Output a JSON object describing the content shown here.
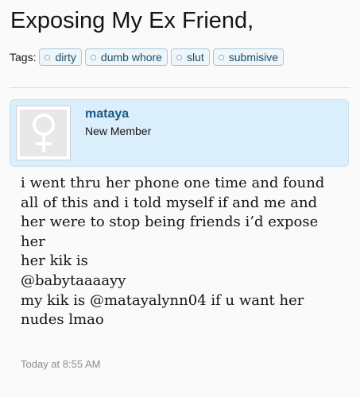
{
  "thread": {
    "title": "Exposing My Ex Friend,"
  },
  "tags": {
    "label": "Tags:",
    "items": [
      "dirty",
      "dumb whore",
      "slut",
      "submisive"
    ]
  },
  "post": {
    "author": {
      "username": "mataya",
      "title": "New Member",
      "avatar_icon": "female-symbol-icon"
    },
    "body_lines": [
      "i went thru her phone one time and found",
      "all of this and i told myself if and me and",
      "her were to stop being friends i’d expose",
      "her",
      "her kik is",
      "@babytaaaayy",
      "my kik is @matayalynn04 if u want her",
      "nudes lmao"
    ],
    "timestamp": "Today at 8:55 AM"
  },
  "colors": {
    "page_background": "#fafafa",
    "user_card_background": "#dbeefb",
    "username_link": "#1a5b85",
    "tag_background": "#eef6fa",
    "tag_text": "#1a4d6a",
    "timestamp": "#8c8c8c"
  }
}
